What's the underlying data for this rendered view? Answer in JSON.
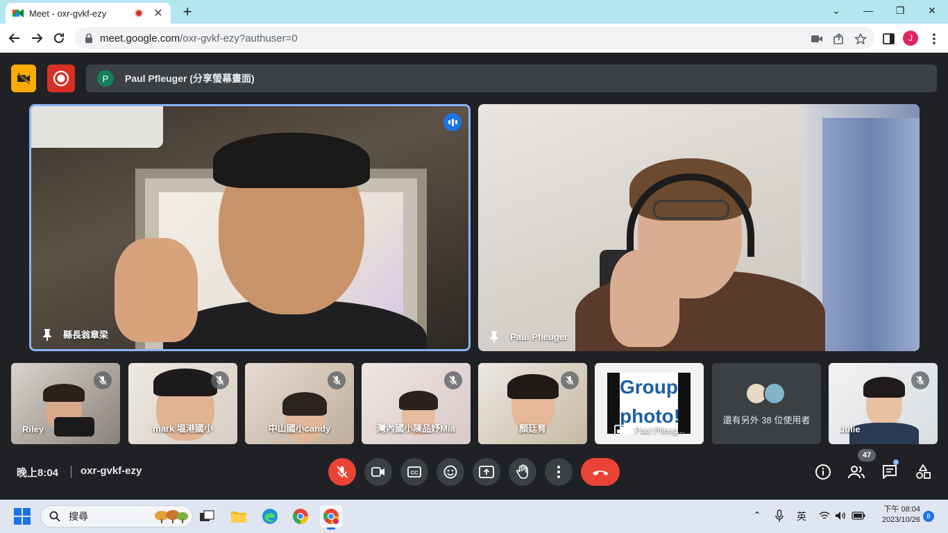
{
  "browser": {
    "tab_title": "Meet - oxr-gvkf-ezy",
    "tab_close": "✕",
    "new_tab": "+",
    "url_host": "meet.google.com",
    "url_path": "/oxr-gvkf-ezy?authuser=0",
    "profile_initial": "J",
    "window_controls": {
      "minimize": "⌄",
      "restore": "—",
      "maximize": "❐",
      "close": "✕"
    }
  },
  "meet": {
    "presenter": {
      "initial": "P",
      "label": "Paul Pfleuger (分享螢幕畫面)"
    },
    "main_tiles": [
      {
        "name": "縣長翁章梁",
        "speaking": true
      },
      {
        "name": "Paul Pfleuger",
        "speaking": false
      }
    ],
    "thumbnails": [
      {
        "name": "Riley",
        "muted": true
      },
      {
        "name": "mark 塭港國小",
        "muted": true
      },
      {
        "name": "中山國小candy",
        "muted": true
      },
      {
        "name": "灣內國小陳品妤Mia",
        "muted": true
      },
      {
        "name": "顏廷育",
        "muted": true
      }
    ],
    "group_tile": {
      "sign_line1": "Group",
      "sign_line2": "photo!",
      "caption": "Paul Pfleug..."
    },
    "others_tile": {
      "text": "還有另外 38 位使用者"
    },
    "julie_tile": {
      "name": "Julie",
      "muted": true
    },
    "footer": {
      "time": "晚上8:04",
      "meeting_code": "oxr-gvkf-ezy",
      "participant_count": "47"
    },
    "colors": {
      "accent_blue": "#8ab4f8",
      "danger_red": "#ea4335",
      "surface": "#3c4043",
      "background": "#202124"
    }
  },
  "taskbar": {
    "search_placeholder": "搜尋",
    "ime": "英",
    "time_line1": "下午 08:04",
    "time_line2": "2023/10/26",
    "notification_count": "8",
    "chevron": "⌃"
  }
}
